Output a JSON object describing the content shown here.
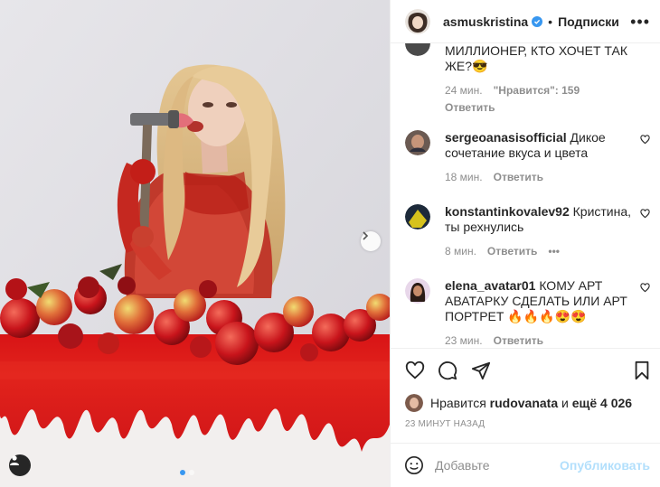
{
  "post": {
    "username": "asmuskristina",
    "follow_label": "Подписки",
    "separator": "•",
    "more_label": "•••"
  },
  "comments": [
    {
      "username": "",
      "text_line1": "МИЛЛИОНЕР, КТО ХОЧЕТ ТАК",
      "text_line2": "ЖЕ?😎",
      "time": "24 мин.",
      "likes": "\"Нравится\": 159",
      "reply": "Ответить"
    },
    {
      "username": "sergeoanasisofficial",
      "text": "Дикое сочетание вкуса и цвета",
      "time": "18 мин.",
      "reply": "Ответить"
    },
    {
      "username": "konstantinkovalev92",
      "text": "Кристина, ты рехнулись",
      "time": "8 мин.",
      "reply": "Ответить",
      "more": "•••"
    },
    {
      "username": "elena_avatar01",
      "text": "КОМУ АРТ АВАТАРКУ СДЕЛАТЬ ИЛИ АРТ ПОРТРЕТ 🔥🔥🔥😍😍",
      "time": "23 мин.",
      "reply": "Ответить"
    }
  ],
  "likes": {
    "prefix": "Нравится",
    "user": "rudovanata",
    "conj": "и",
    "others": "ещё 4 026"
  },
  "posted_ago": "23 МИНУТ НАЗАД",
  "composer": {
    "placeholder": "Добавьте",
    "publish_label": "Опубликовать"
  },
  "icons": {
    "header_avatar": "avatar",
    "verified": "verified-badge-icon",
    "like": "heart-icon",
    "comment": "comment-icon",
    "share": "paper-plane-icon",
    "save": "bookmark-icon",
    "emoji": "emoji-icon",
    "next": "chevron-right-icon",
    "tag": "user-tag-icon"
  },
  "colors": {
    "accent": "#3897f0",
    "publish_disabled": "#b2dffc",
    "muted": "#8e8e8e"
  },
  "carousel": {
    "slides": 2,
    "active": 1
  }
}
